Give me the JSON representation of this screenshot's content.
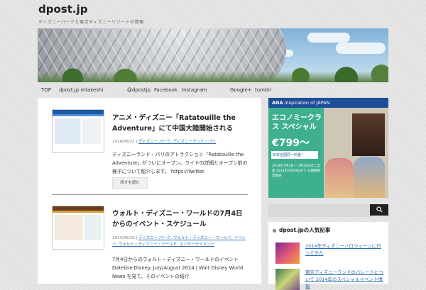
{
  "site": {
    "title": "dpost.jp",
    "tagline": "ディズニーパークと東京ディズニーリゾートの情報"
  },
  "nav": {
    "items": [
      "TOP",
      "dpost.jp mtakeshi",
      "@dpostjp",
      "Facebook",
      "Instagram",
      "Google+",
      "tumblr"
    ]
  },
  "posts": [
    {
      "title": "アニメ・ディズニー「Ratatouille the Adventure」にて中国大陸開始される",
      "date": "2014/06/21",
      "meta_sep": "|",
      "categories": "ディズニー パーク, ディズニーランド・パリ",
      "excerpt": "ディズニーランド・パリのアトラクション「Ratatouille the Adventure」がついにオープン。ライドの詳細とオープン前の様子について紹介します。 https://twitter.",
      "more": "続きを読む"
    },
    {
      "title": "ウォルト・ディズニー・ワールドの7月4日からのイベント・スケジュール",
      "date": "2014/06/20",
      "meta_sep": "|",
      "categories": "ディズニー パーク, ウォルト・ディズニー・ワールド, イベント, ウォルト・ディズニー・ワールド, エンターテイメント",
      "excerpt": "7月4日からのウォルト・ディズニー・ワールドのイベント Dateline Disney: July/August 2014 | Walt Disney World News を見て、そのイベントの紹介"
    }
  ],
  "ad": {
    "brand": "ANA",
    "header": "Inspiration of JAPAN",
    "headline": "エコノミークラス スペシャル",
    "price": "€799〜",
    "note": "日本全国同一料金！",
    "small": "2014年7月1日〜 1月16日のご出発 2014年6月20日まで の期間限定販売"
  },
  "search": {
    "placeholder": "",
    "button_icon": "search-icon"
  },
  "widget": {
    "title": "dpost.jpの人気記事",
    "items": [
      "2014年ディズニーハロウィーンに行ってきた",
      "東京ディズニーランドのパレードについて 2014年のスペシャルイベント情報"
    ]
  }
}
